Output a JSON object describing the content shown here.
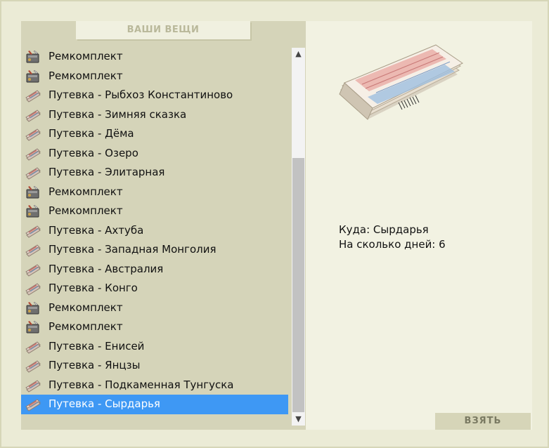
{
  "panel": {
    "title": "ВАШИ ВЕЩИ"
  },
  "items": [
    {
      "label": "Ремкомплект",
      "icon": "repair-kit-icon",
      "selected": false
    },
    {
      "label": "Ремкомплект",
      "icon": "repair-kit-icon",
      "selected": false
    },
    {
      "label": "Путевка - Рыбхоз Константиново",
      "icon": "voucher-icon",
      "selected": false
    },
    {
      "label": "Путевка - Зимняя сказка",
      "icon": "voucher-icon",
      "selected": false
    },
    {
      "label": "Путевка - Дёма",
      "icon": "voucher-icon",
      "selected": false
    },
    {
      "label": "Путевка - Озеро",
      "icon": "voucher-icon",
      "selected": false
    },
    {
      "label": "Путевка - Элитарная",
      "icon": "voucher-icon",
      "selected": false
    },
    {
      "label": "Ремкомплект",
      "icon": "repair-kit-icon",
      "selected": false
    },
    {
      "label": "Ремкомплект",
      "icon": "repair-kit-icon",
      "selected": false
    },
    {
      "label": "Путевка - Ахтуба",
      "icon": "voucher-icon",
      "selected": false
    },
    {
      "label": "Путевка - Западная Монголия",
      "icon": "voucher-icon",
      "selected": false
    },
    {
      "label": "Путевка - Австралия",
      "icon": "voucher-icon",
      "selected": false
    },
    {
      "label": "Путевка - Конго",
      "icon": "voucher-icon",
      "selected": false
    },
    {
      "label": "Ремкомплект",
      "icon": "repair-kit-icon",
      "selected": false
    },
    {
      "label": "Ремкомплект",
      "icon": "repair-kit-icon",
      "selected": false
    },
    {
      "label": "Путевка - Енисей",
      "icon": "voucher-icon",
      "selected": false
    },
    {
      "label": "Путевка - Янцзы",
      "icon": "voucher-icon",
      "selected": false
    },
    {
      "label": "Путевка - Подкаменная Тунгуска",
      "icon": "voucher-icon",
      "selected": false
    },
    {
      "label": "Путевка - Сырдарья",
      "icon": "voucher-icon",
      "selected": true
    }
  ],
  "details": {
    "image": "voucher-tickets-image",
    "line1": "Куда: Сырдарья",
    "line2": "На сколько дней: 6"
  },
  "actions": {
    "take_label": "ВЗЯТЬ"
  },
  "colors": {
    "selection": "#3e98f4",
    "panel_bg": "#d5d4b9",
    "detail_bg": "#f2f2e2"
  }
}
